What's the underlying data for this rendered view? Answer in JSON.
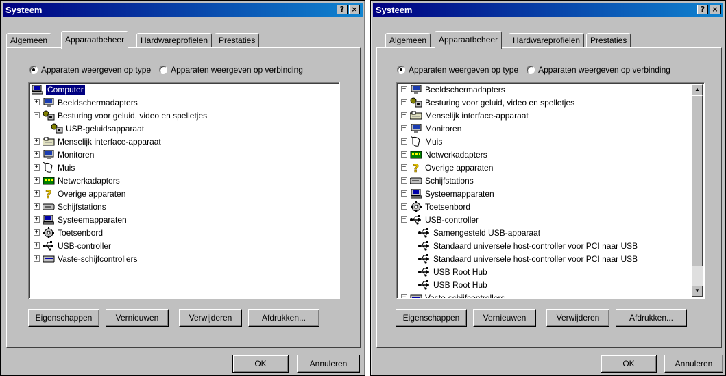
{
  "left": {
    "title": "Systeem",
    "help": "?",
    "close": "×",
    "tabs": [
      "Algemeen",
      "Apparaatbeheer",
      "Hardwareprofielen",
      "Prestaties"
    ],
    "radio_type": "Apparaten weergeven op type",
    "radio_connection": "Apparaten weergeven op verbinding",
    "tree": [
      {
        "label": "Computer",
        "icon": "computer",
        "level": 0,
        "expander": "",
        "selected": true
      },
      {
        "label": "Beeldschermadapters",
        "icon": "monitor",
        "level": 1,
        "expander": "+"
      },
      {
        "label": "Besturing voor geluid, video en spelletjes",
        "icon": "sound",
        "level": 1,
        "expander": "−"
      },
      {
        "label": "USB-geluidsapparaat",
        "icon": "sound",
        "level": 2,
        "expander": ""
      },
      {
        "label": "Menselijk interface-apparaat",
        "icon": "hid",
        "level": 1,
        "expander": "+"
      },
      {
        "label": "Monitoren",
        "icon": "monitor",
        "level": 1,
        "expander": "+"
      },
      {
        "label": "Muis",
        "icon": "mouse",
        "level": 1,
        "expander": "+"
      },
      {
        "label": "Netwerkadapters",
        "icon": "network",
        "level": 1,
        "expander": "+"
      },
      {
        "label": "Overige apparaten",
        "icon": "question",
        "level": 1,
        "expander": "+"
      },
      {
        "label": "Schijfstations",
        "icon": "disk",
        "level": 1,
        "expander": "+"
      },
      {
        "label": "Systeemapparaten",
        "icon": "computer",
        "level": 1,
        "expander": "+"
      },
      {
        "label": "Toetsenbord",
        "icon": "keyboard",
        "level": 1,
        "expander": "+"
      },
      {
        "label": "USB-controller",
        "icon": "usb",
        "level": 1,
        "expander": "+"
      },
      {
        "label": "Vaste-schijfcontrollers",
        "icon": "hdc",
        "level": 1,
        "expander": "+"
      }
    ],
    "buttons": {
      "properties": "Eigenschappen",
      "refresh": "Vernieuwen",
      "remove": "Verwijderen",
      "print": "Afdrukken..."
    },
    "ok": "OK",
    "cancel": "Annuleren"
  },
  "right": {
    "title": "Systeem",
    "help": "?",
    "close": "×",
    "tabs": [
      "Algemeen",
      "Apparaatbeheer",
      "Hardwareprofielen",
      "Prestaties"
    ],
    "radio_type": "Apparaten weergeven op type",
    "radio_connection": "Apparaten weergeven op verbinding",
    "tree": [
      {
        "label": "Beeldschermadapters",
        "icon": "monitor",
        "level": 1,
        "expander": "+"
      },
      {
        "label": "Besturing voor geluid, video en spelletjes",
        "icon": "sound",
        "level": 1,
        "expander": "+"
      },
      {
        "label": "Menselijk interface-apparaat",
        "icon": "hid",
        "level": 1,
        "expander": "+"
      },
      {
        "label": "Monitoren",
        "icon": "monitor",
        "level": 1,
        "expander": "+"
      },
      {
        "label": "Muis",
        "icon": "mouse",
        "level": 1,
        "expander": "+"
      },
      {
        "label": "Netwerkadapters",
        "icon": "network",
        "level": 1,
        "expander": "+"
      },
      {
        "label": "Overige apparaten",
        "icon": "question",
        "level": 1,
        "expander": "+"
      },
      {
        "label": "Schijfstations",
        "icon": "disk",
        "level": 1,
        "expander": "+"
      },
      {
        "label": "Systeemapparaten",
        "icon": "computer",
        "level": 1,
        "expander": "+"
      },
      {
        "label": "Toetsenbord",
        "icon": "keyboard",
        "level": 1,
        "expander": "+"
      },
      {
        "label": "USB-controller",
        "icon": "usb",
        "level": 1,
        "expander": "−"
      },
      {
        "label": "Samengesteld USB-apparaat",
        "icon": "usb",
        "level": 2,
        "expander": ""
      },
      {
        "label": "Standaard universele host-controller voor PCI naar USB",
        "icon": "usb",
        "level": 2,
        "expander": ""
      },
      {
        "label": "Standaard universele host-controller voor PCI naar USB",
        "icon": "usb",
        "level": 2,
        "expander": ""
      },
      {
        "label": "USB Root Hub",
        "icon": "usb",
        "level": 2,
        "expander": ""
      },
      {
        "label": "USB Root Hub",
        "icon": "usb",
        "level": 2,
        "expander": ""
      },
      {
        "label": "Vaste-schijfcontrollers",
        "icon": "hdc",
        "level": 1,
        "expander": "+"
      }
    ],
    "buttons": {
      "properties": "Eigenschappen",
      "refresh": "Vernieuwen",
      "remove": "Verwijderen",
      "print": "Afdrukken..."
    },
    "ok": "OK",
    "cancel": "Annuleren",
    "scroll_up": "▲",
    "scroll_down": "▼"
  }
}
